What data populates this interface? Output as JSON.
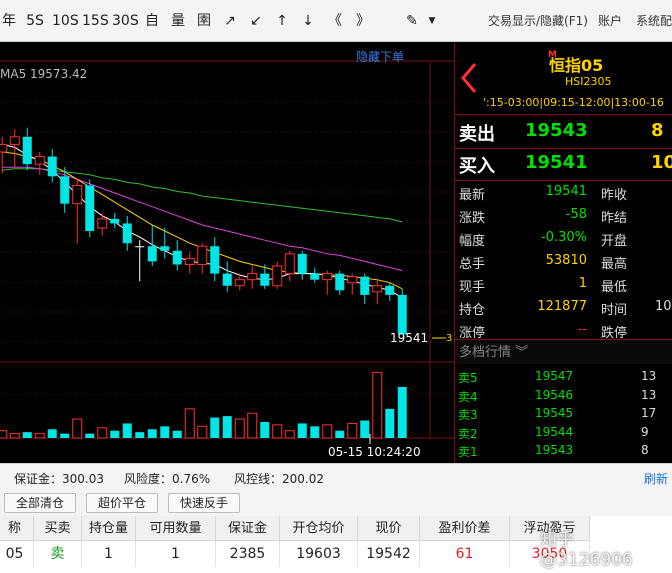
{
  "toolbar": {
    "buttons": [
      "年",
      "5S",
      "10S",
      "15S",
      "30S",
      "自",
      "量",
      "圉",
      "↗",
      "↙",
      "↑",
      "↓",
      "《",
      "》",
      "✎"
    ],
    "menu_display": "交易显示/隐藏(F1)",
    "menu_account": "账户",
    "menu_system": "系统配"
  },
  "chart": {
    "hide_order": "隐藏下单",
    "ma_label": "MA5",
    "ma_value": "19573.42",
    "last_price_tag": "19541",
    "time_label": "05-15 10:24:20",
    "tick_mark": "3",
    "colors": {
      "up": "#ff3030",
      "down": "#00e5e5",
      "ma5": "#ffffff",
      "ma10": "#ffd200",
      "ma20": "#e040e0",
      "ma60": "#30c030"
    }
  },
  "chart_data": {
    "type": "candlestick",
    "candles": [
      {
        "o": 19640,
        "h": 19650,
        "l": 19626,
        "c": 19645
      },
      {
        "o": 19645,
        "h": 19655,
        "l": 19630,
        "c": 19650
      },
      {
        "o": 19650,
        "h": 19656,
        "l": 19628,
        "c": 19632
      },
      {
        "o": 19632,
        "h": 19640,
        "l": 19625,
        "c": 19637
      },
      {
        "o": 19637,
        "h": 19642,
        "l": 19620,
        "c": 19624
      },
      {
        "o": 19624,
        "h": 19630,
        "l": 19600,
        "c": 19606
      },
      {
        "o": 19606,
        "h": 19622,
        "l": 19580,
        "c": 19618
      },
      {
        "o": 19618,
        "h": 19622,
        "l": 19584,
        "c": 19588
      },
      {
        "o": 19590,
        "h": 19600,
        "l": 19585,
        "c": 19596
      },
      {
        "o": 19596,
        "h": 19600,
        "l": 19590,
        "c": 19593
      },
      {
        "o": 19593,
        "h": 19598,
        "l": 19575,
        "c": 19580
      },
      {
        "o": 19578,
        "h": 19582,
        "l": 19555,
        "c": 19578
      },
      {
        "o": 19578,
        "h": 19592,
        "l": 19565,
        "c": 19568
      },
      {
        "o": 19578,
        "h": 19590,
        "l": 19570,
        "c": 19575
      },
      {
        "o": 19575,
        "h": 19582,
        "l": 19562,
        "c": 19566
      },
      {
        "o": 19566,
        "h": 19574,
        "l": 19560,
        "c": 19570
      },
      {
        "o": 19566,
        "h": 19580,
        "l": 19560,
        "c": 19578
      },
      {
        "o": 19578,
        "h": 19584,
        "l": 19555,
        "c": 19560
      },
      {
        "o": 19560,
        "h": 19568,
        "l": 19548,
        "c": 19552
      },
      {
        "o": 19552,
        "h": 19560,
        "l": 19549,
        "c": 19556
      },
      {
        "o": 19556,
        "h": 19565,
        "l": 19550,
        "c": 19560
      },
      {
        "o": 19560,
        "h": 19566,
        "l": 19550,
        "c": 19552
      },
      {
        "o": 19552,
        "h": 19568,
        "l": 19550,
        "c": 19565
      },
      {
        "o": 19560,
        "h": 19575,
        "l": 19555,
        "c": 19573
      },
      {
        "o": 19573,
        "h": 19575,
        "l": 19556,
        "c": 19560
      },
      {
        "o": 19560,
        "h": 19564,
        "l": 19554,
        "c": 19556
      },
      {
        "o": 19556,
        "h": 19562,
        "l": 19546,
        "c": 19560
      },
      {
        "o": 19560,
        "h": 19562,
        "l": 19546,
        "c": 19549
      },
      {
        "o": 19554,
        "h": 19560,
        "l": 19546,
        "c": 19558
      },
      {
        "o": 19558,
        "h": 19560,
        "l": 19540,
        "c": 19546
      },
      {
        "o": 19548,
        "h": 19556,
        "l": 19540,
        "c": 19552
      },
      {
        "o": 19552,
        "h": 19554,
        "l": 19542,
        "c": 19546
      },
      {
        "o": 19546,
        "h": 19550,
        "l": 19520,
        "c": 19520
      }
    ],
    "ma5": [
      19645,
      19643,
      19638,
      19634,
      19628,
      19620,
      19612,
      19604,
      19598,
      19594,
      19588,
      19584,
      19579,
      19575,
      19571,
      19568,
      19567,
      19566,
      19562,
      19559,
      19557,
      19556,
      19557,
      19560,
      19560,
      19560,
      19559,
      19557,
      19555,
      19553,
      19551,
      19549,
      19544
    ],
    "ma10": [
      19640,
      19639,
      19637,
      19635,
      19631,
      19627,
      19622,
      19617,
      19612,
      19607,
      19602,
      19597,
      19592,
      19588,
      19584,
      19580,
      19577,
      19574,
      19571,
      19568,
      19566,
      19564,
      19562,
      19561,
      19560,
      19560,
      19559,
      19559,
      19558,
      19557,
      19556,
      19554,
      19550
    ],
    "ma20": [
      19630,
      19630,
      19630,
      19629,
      19627,
      19625,
      19622,
      19619,
      19616,
      19613,
      19610,
      19607,
      19604,
      19601,
      19598,
      19595,
      19592,
      19590,
      19588,
      19586,
      19584,
      19582,
      19580,
      19578,
      19577,
      19575,
      19573,
      19572,
      19570,
      19568,
      19566,
      19564,
      19562
    ],
    "ma60": [
      19628,
      19629,
      19629,
      19629,
      19628,
      19627,
      19626,
      19625,
      19623,
      19622,
      19620,
      19619,
      19617,
      19616,
      19614,
      19613,
      19611,
      19610,
      19609,
      19608,
      19607,
      19606,
      19605,
      19604,
      19603,
      19602,
      19601,
      19600,
      19599,
      19598,
      19597,
      19596,
      19594
    ],
    "volume": [
      5,
      3,
      4,
      3,
      6,
      3,
      13,
      3,
      7,
      5,
      10,
      4,
      6,
      8,
      5,
      20,
      8,
      14,
      15,
      13,
      17,
      11,
      9,
      5,
      10,
      8,
      9,
      5,
      10,
      12,
      45,
      20,
      35
    ],
    "ylim": [
      19515,
      19665
    ],
    "vol_ylim": [
      0,
      48
    ]
  },
  "quote": {
    "symbol_tag": "M",
    "symbol_name": "恒指05",
    "symbol_code": "HSI2305",
    "sessions": "':15-03:00|09:15-12:00|13:00-16",
    "sell_label": "卖出",
    "sell_price": "19543",
    "sell_qty": "8",
    "buy_label": "买入",
    "buy_price": "19541",
    "buy_qty": "10",
    "rows": [
      {
        "label": "最新",
        "value": "19541",
        "vcls": "green",
        "label2": "昨收",
        "value2": ""
      },
      {
        "label": "涨跌",
        "value": "-58",
        "vcls": "green",
        "label2": "昨结",
        "value2": ""
      },
      {
        "label": "幅度",
        "value": "-0.30%",
        "vcls": "green",
        "label2": "开盘",
        "value2": ""
      },
      {
        "label": "总手",
        "value": "53810",
        "vcls": "yellow",
        "label2": "最高",
        "value2": ""
      },
      {
        "label": "现手",
        "value": "1",
        "vcls": "yellow",
        "label2": "最低",
        "value2": ""
      },
      {
        "label": "持仓",
        "value": "121877",
        "vcls": "yellow",
        "label2": "时间",
        "value2": "10"
      },
      {
        "label": "涨停",
        "value": "--",
        "vcls": "red",
        "label2": "跌停",
        "value2": ""
      }
    ],
    "depth_title": "多档行情",
    "depth": [
      {
        "label": "卖5",
        "price": "19547",
        "qty": "13"
      },
      {
        "label": "卖4",
        "price": "19546",
        "qty": "13"
      },
      {
        "label": "卖3",
        "price": "19545",
        "qty": "17"
      },
      {
        "label": "卖2",
        "price": "19544",
        "qty": "9"
      },
      {
        "label": "卖1",
        "price": "19543",
        "qty": "8"
      }
    ]
  },
  "account": {
    "margin": "保证金：300.03",
    "risk": "风险度：0.76%",
    "risk_line": "风控线：200.02",
    "refresh": "刷新"
  },
  "actions": {
    "close_all": "全部清仓",
    "over_close": "超价平仓",
    "quick_reverse": "快速反手"
  },
  "table": {
    "headers": [
      "称",
      "买卖",
      "持仓量",
      "可用数量",
      "保证金",
      "开仓均价",
      "现价",
      "盈利价差",
      "浮动盈亏"
    ],
    "row": [
      "05",
      "卖",
      "1",
      "1",
      "2385",
      "19603",
      "19542",
      "61",
      "3050"
    ]
  },
  "watermark": "知乎 @3126906"
}
